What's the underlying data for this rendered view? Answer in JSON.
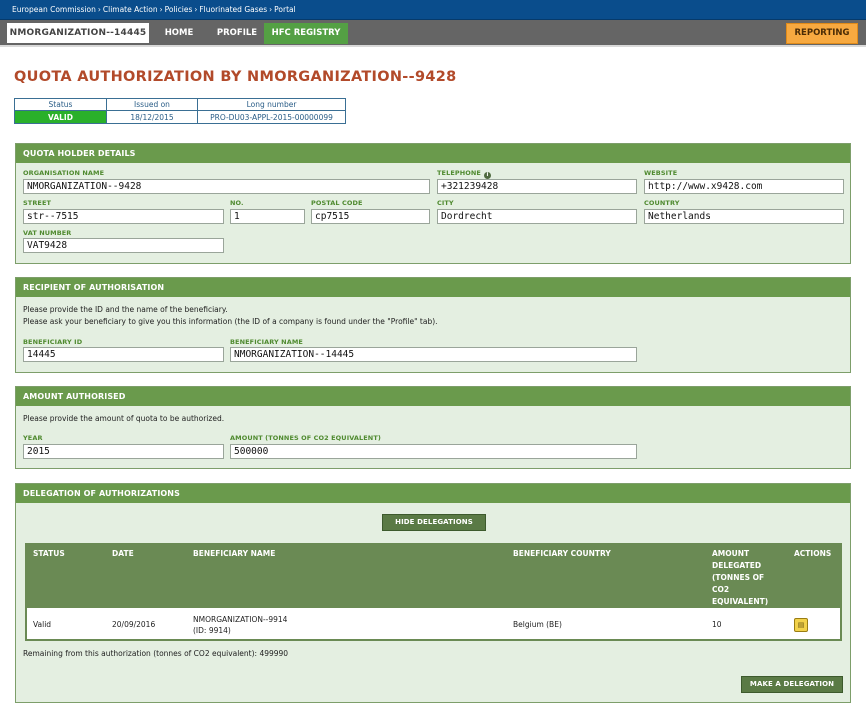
{
  "breadcrumb": [
    "European Commission",
    "Climate Action",
    "Policies",
    "Fluorinated Gases",
    "Portal"
  ],
  "nav": {
    "org_tab": "NMORGANIZATION--14445",
    "home": "HOME",
    "profile": "PROFILE",
    "hfc_registry": "HFC REGISTRY",
    "reporting": "REPORTING"
  },
  "title": "QUOTA AUTHORIZATION BY NMORGANIZATION--9428",
  "status": {
    "headers": [
      "Status",
      "Issued on",
      "Long number"
    ],
    "status_value": "VALID",
    "issued_on": "18/12/2015",
    "long_number": "PRO-DU03-APPL-2015-00000099"
  },
  "holder": {
    "heading": "QUOTA HOLDER DETAILS",
    "org_name_label": "ORGANISATION NAME",
    "org_name": "NMORGANIZATION--9428",
    "telephone_label": "TELEPHONE",
    "telephone": "+321239428",
    "website_label": "WEBSITE",
    "website": "http://www.x9428.com",
    "street_label": "STREET",
    "street": "str--7515",
    "no_label": "NO.",
    "no": "1",
    "postal_label": "POSTAL CODE",
    "postal": "cp7515",
    "city_label": "CITY",
    "city": "Dordrecht",
    "country_label": "COUNTRY",
    "country": "Netherlands",
    "vat_label": "VAT NUMBER",
    "vat": "VAT9428"
  },
  "recipient": {
    "heading": "RECIPIENT OF AUTHORISATION",
    "line1": "Please provide the ID and the name of the beneficiary.",
    "line2": "Please ask your beneficiary to give you this information (the ID of a company is found under the \"Profile\" tab).",
    "id_label": "BENEFICIARY ID",
    "id": "14445",
    "name_label": "BENEFICIARY NAME",
    "name": "NMORGANIZATION--14445"
  },
  "amount": {
    "heading": "AMOUNT AUTHORISED",
    "line": "Please provide the amount of quota to be authorized.",
    "year_label": "YEAR",
    "year": "2015",
    "amount_label": "AMOUNT (TONNES OF CO2 EQUIVALENT)",
    "amount": "500000"
  },
  "delegation": {
    "heading": "DELEGATION OF AUTHORIZATIONS",
    "hide_button": "HIDE DELEGATIONS",
    "columns": {
      "status": "STATUS",
      "date": "DATE",
      "beneficiary_name": "BENEFICIARY NAME",
      "beneficiary_country": "BENEFICIARY COUNTRY",
      "amount_l1": "AMOUNT",
      "amount_l2": "DELEGATED",
      "amount_l3": "(TONNES OF",
      "amount_l4": "CO2",
      "amount_l5": "EQUIVALENT)",
      "actions": "ACTIONS"
    },
    "row": {
      "status": "Valid",
      "date": "20/09/2016",
      "name": "NMORGANIZATION--9914",
      "id": "(ID: 9914)",
      "country": "Belgium (BE)",
      "amount": "10"
    },
    "remaining": "Remaining from this authorization (tonnes of CO2 equivalent): 499990",
    "make_button": "MAKE A DELEGATION"
  }
}
